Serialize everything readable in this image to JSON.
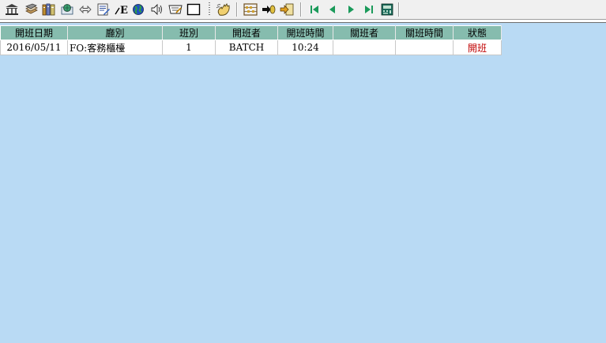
{
  "toolbar": {
    "buttons": [
      {
        "icon": "bank-icon"
      },
      {
        "icon": "book-stack-icon"
      },
      {
        "icon": "binders-icon"
      },
      {
        "icon": "globe-card-icon"
      },
      {
        "icon": "swap-arrows-icon"
      },
      {
        "icon": "document-edit-icon"
      },
      {
        "icon": "font-e-icon"
      },
      {
        "icon": "earth-icon"
      },
      {
        "icon": "speaker-icon"
      },
      {
        "icon": "pen-note-icon"
      },
      {
        "icon": "blank-frame-icon"
      },
      {
        "icon": "hand-wave-icon"
      },
      {
        "icon": "abacus-icon"
      },
      {
        "icon": "import-arrow-icon"
      },
      {
        "icon": "export-arrow-icon"
      },
      {
        "icon": "first-record-icon"
      },
      {
        "icon": "previous-record-icon"
      },
      {
        "icon": "next-record-icon"
      },
      {
        "icon": "last-record-icon"
      },
      {
        "icon": "calculator-icon"
      }
    ]
  },
  "grid": {
    "columns": [
      "開班日期",
      "廳別",
      "班別",
      "開班者",
      "開班時間",
      "關班者",
      "關班時間",
      "狀態"
    ],
    "rows": [
      {
        "open_date": "2016/05/11",
        "outlet": "FO:客務櫃檯",
        "shift": "1",
        "opened_by": "BATCH",
        "open_time": "10:24",
        "closed_by": "",
        "close_time": "",
        "status": "開班"
      }
    ]
  },
  "colors": {
    "background": "#b9daf4",
    "header": "#86bcae",
    "status_text": "#c00000"
  }
}
